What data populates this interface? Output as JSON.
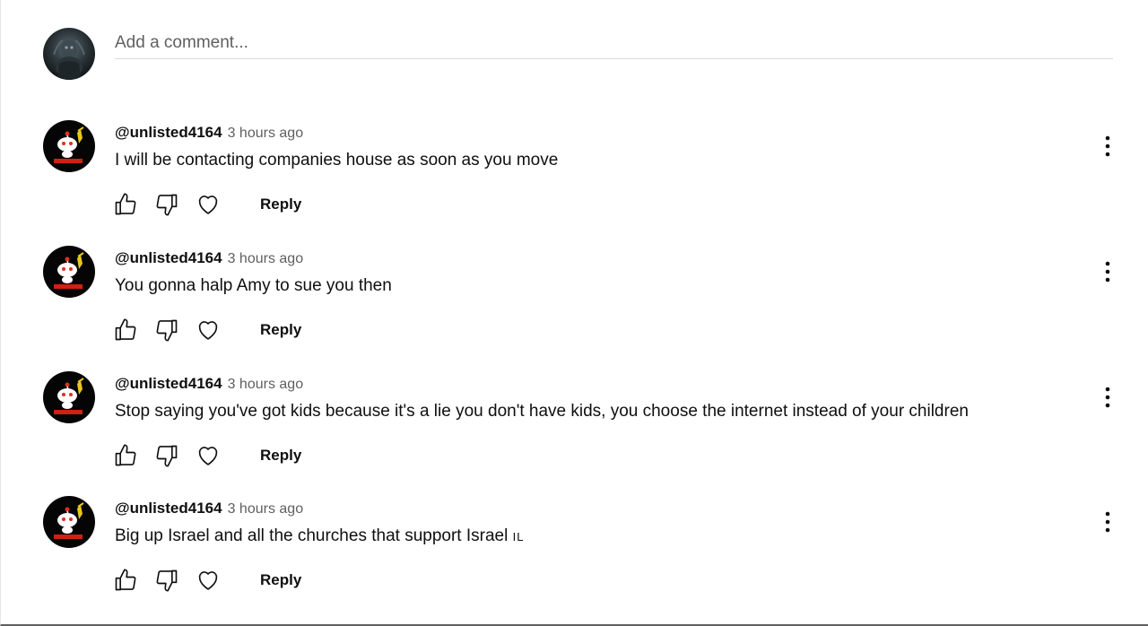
{
  "add_comment": {
    "placeholder": "Add a comment...",
    "avatar_icon": "user-avatar"
  },
  "comments": [
    {
      "author": "@unlisted4164",
      "time": "3 hours ago",
      "text": "I will be contacting companies house as soon as  you move",
      "text_suffix": "",
      "reply_label": "Reply"
    },
    {
      "author": "@unlisted4164",
      "time": "3 hours ago",
      "text": "You gonna halp Amy to sue you then",
      "text_suffix": "",
      "reply_label": "Reply"
    },
    {
      "author": "@unlisted4164",
      "time": "3 hours ago",
      "text": "Stop saying you've got kids because it's a lie you don't have kids, you choose the internet instead of your children",
      "text_suffix": "",
      "reply_label": "Reply"
    },
    {
      "author": "@unlisted4164",
      "time": "3 hours ago",
      "text": "Big up Israel and all the churches that support Israel",
      "text_suffix": "IL",
      "reply_label": "Reply"
    }
  ],
  "icons": {
    "like": "thumbs-up-icon",
    "dislike": "thumbs-down-icon",
    "heart": "heart-icon",
    "menu": "more-vertical-icon"
  },
  "colors": {
    "text_primary": "#0f0f0f",
    "text_secondary": "#606060",
    "divider": "#d9d9d9"
  }
}
